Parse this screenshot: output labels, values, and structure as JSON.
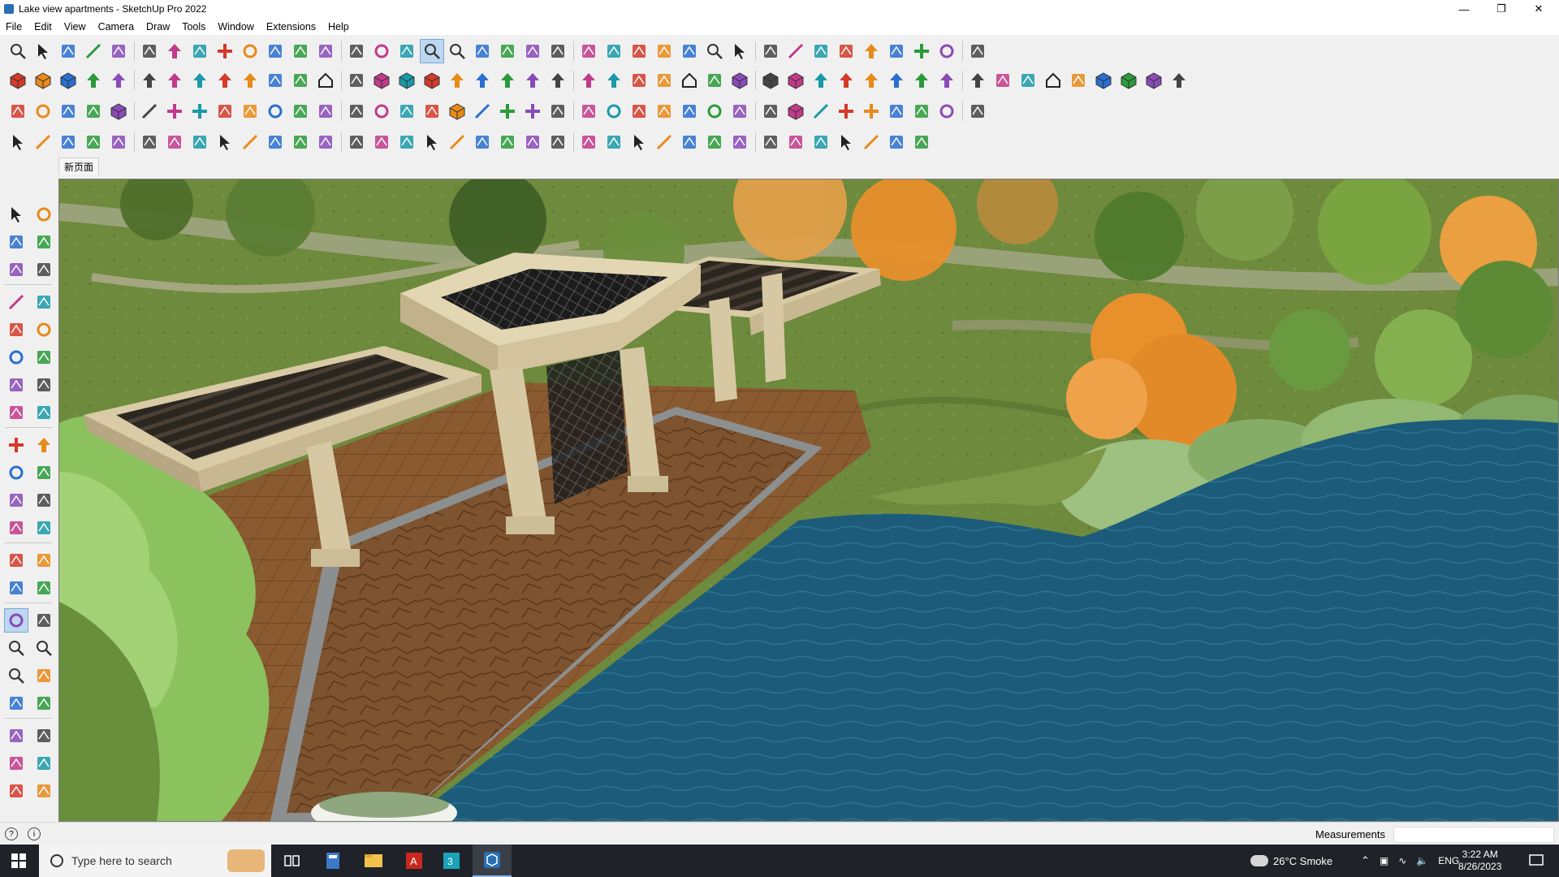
{
  "window": {
    "title": "Lake view apartments - SketchUp Pro 2022"
  },
  "menu": [
    "File",
    "Edit",
    "View",
    "Camera",
    "Draw",
    "Tools",
    "Window",
    "Extensions",
    "Help"
  ],
  "scene_tab": "新页面",
  "status": {
    "measurements_label": "Measurements",
    "measurements_value": ""
  },
  "taskbar": {
    "search_placeholder": "Type here to search",
    "weather": "26°C  Smoke",
    "language": "ENG",
    "time": "3:22 AM",
    "date": "8/26/2023"
  },
  "colors": {
    "accent": "#0078d7",
    "water": "#1a5b78",
    "lawn": "#6f8a3b",
    "paving": "#8a5a30",
    "stone": "#d9cba6",
    "autumn_tree": "#e8902c"
  },
  "icons": {
    "window_controls": [
      "minimize-icon",
      "restore-icon",
      "close-icon"
    ],
    "toolbar_row1": [
      "zoom-icon",
      "select-icon",
      "eraser-icon",
      "pencil-icon",
      "lasso-icon",
      "paint-bucket-icon",
      "push-pull-icon",
      "follow-me-icon",
      "move-icon",
      "rotate-icon",
      "scale-icon",
      "tape-measure-icon",
      "text-icon",
      "paint-icon",
      "orbit-icon",
      "pan-icon",
      "zoom-window-icon",
      "zoom-extents-icon",
      "section-icon",
      "layers-icon",
      "components-icon",
      "styles-icon",
      "camera-icon",
      "solid-icon",
      "axis-icon",
      "undo-icon",
      "redo-icon"
    ],
    "toolbar_row2": [
      "cube-icon",
      "cube-gray-icon",
      "cube-green-icon",
      "push-pull-red-icon",
      "arrow-down-icon",
      "arrow-down-blue-icon",
      "arrow-red-icon",
      "arrow-green-icon",
      "arrow-orange-icon",
      "arrow-pink-icon",
      "curve-icon",
      "section-blue-icon",
      "house-icon",
      "shapes-icon"
    ],
    "toolbar_row3": [
      "plane-icon",
      "rotate-orange-icon",
      "square-red-icon",
      "frame-icon",
      "cube-orange-icon",
      "line-icon",
      "plus-icon",
      "cross-icon",
      "cone-icon",
      "spiral-icon",
      "circle-dot-icon",
      "tree-icon",
      "grid-icon"
    ],
    "toolbar_row4": [
      "select-3d-icon",
      "spline-icon",
      "sweep-icon",
      "loft-icon",
      "wall-icon",
      "stair-icon",
      "mesh-icon",
      "hatch-icon"
    ]
  }
}
